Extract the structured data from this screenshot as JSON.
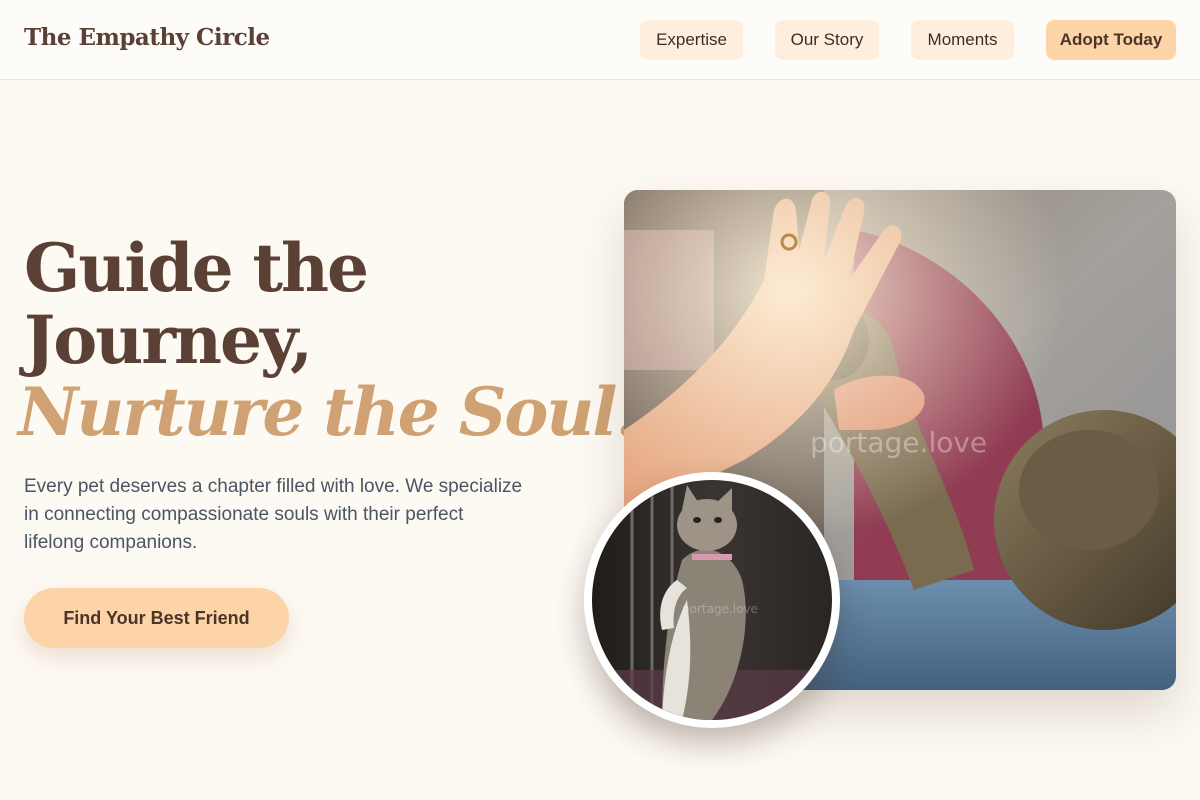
{
  "header": {
    "brand": "The Empathy Circle",
    "nav": [
      {
        "label": "Expertise"
      },
      {
        "label": "Our Story"
      },
      {
        "label": "Moments"
      },
      {
        "label": "Adopt Today"
      }
    ]
  },
  "hero": {
    "headline_line1": "Guide the",
    "headline_line2": "Journey,",
    "headline_accent": "Nurture the Soul.",
    "lead": "Every pet deserves a chapter filled with love. We specialize in connecting compassionate souls with their perfect lifelong companions.",
    "cta_label": "Find Your Best Friend"
  },
  "images": {
    "main_watermark": "portage.love",
    "circle_watermark": "portage.love"
  },
  "colors": {
    "background": "#fdf9f3",
    "brand_brown": "#5b4035",
    "accent_tan": "#d0a273",
    "button_peach": "#fdd3a8",
    "nav_peach": "#ffeedd"
  }
}
